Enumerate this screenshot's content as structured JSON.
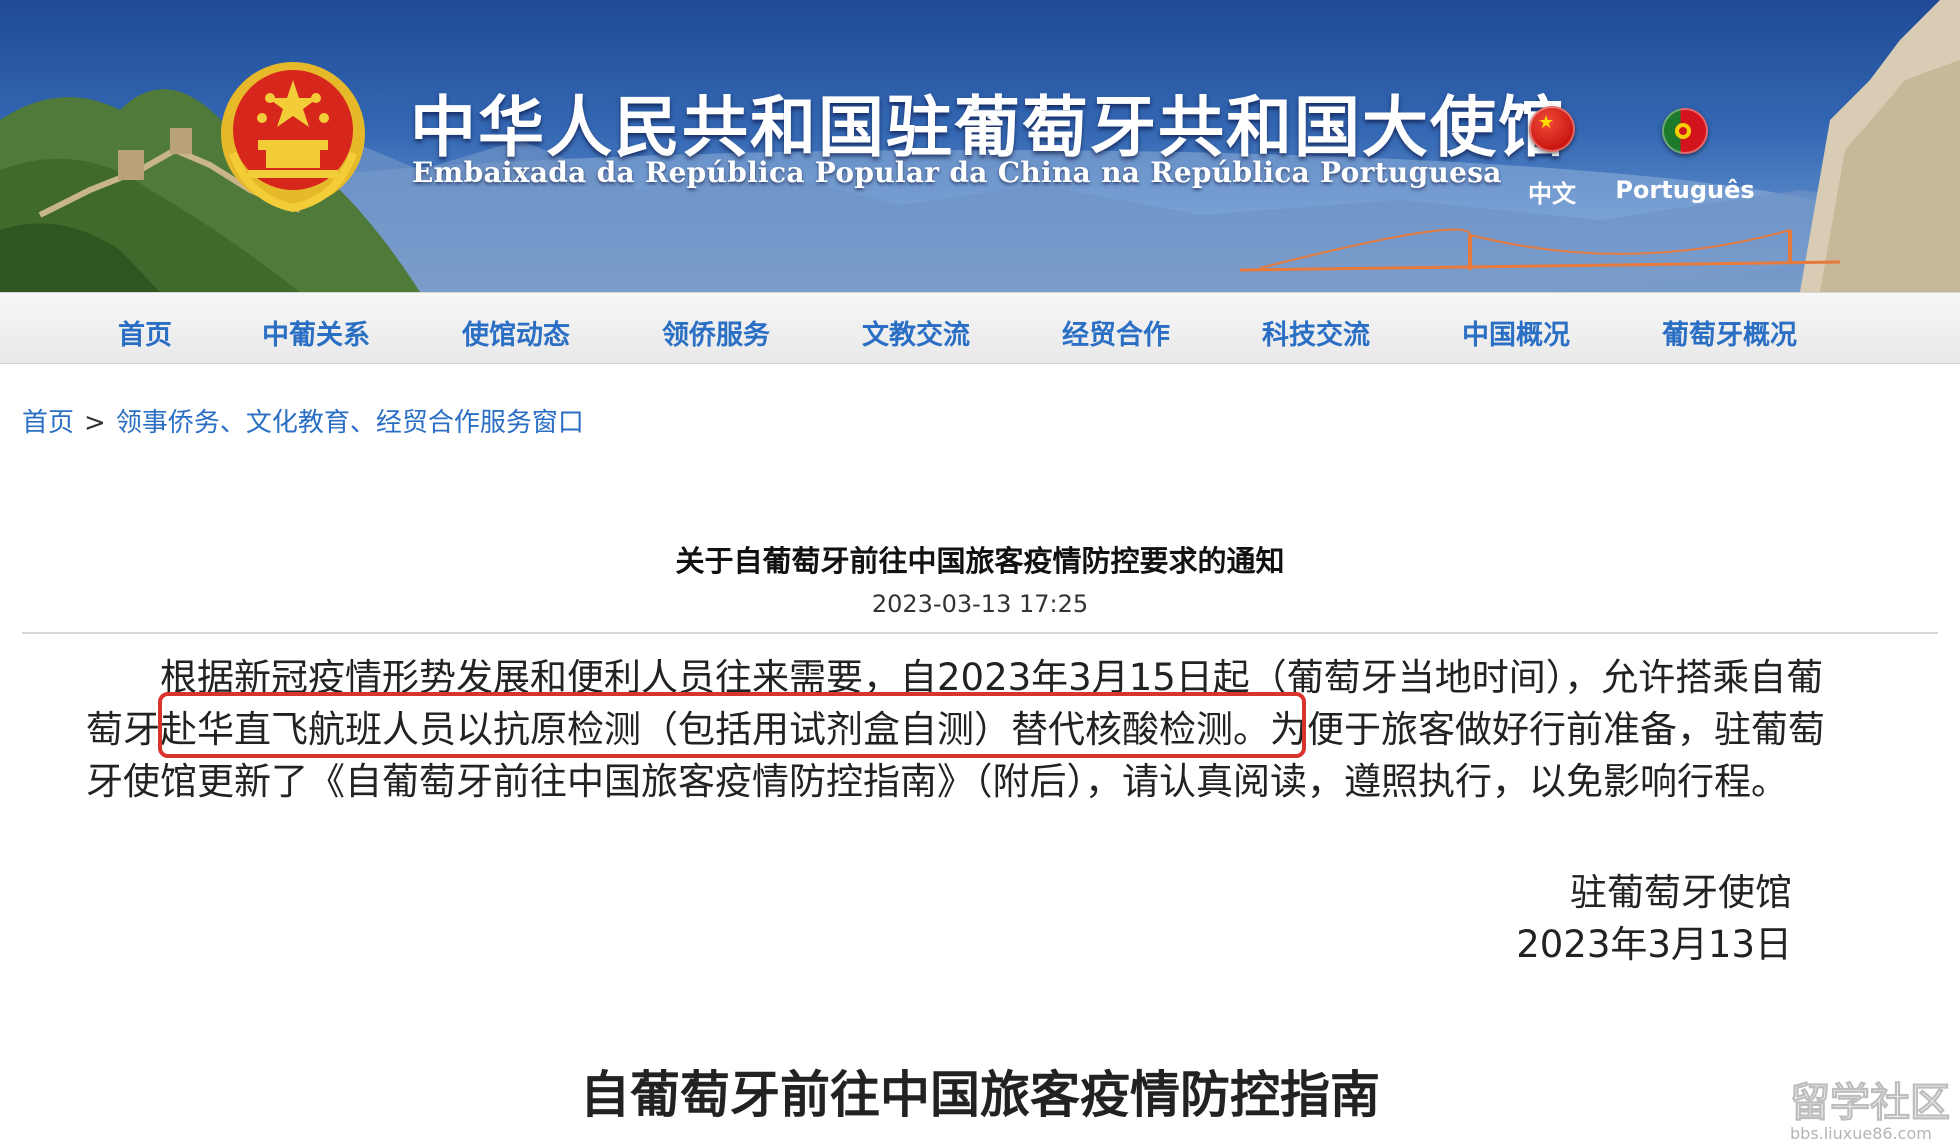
{
  "header": {
    "title_cn": "中华人民共和国驻葡萄牙共和国大使馆",
    "title_pt": "Embaixada da República Popular da China na República Portuguesa",
    "languages": [
      {
        "label": "中文",
        "icon": "china-flag-icon"
      },
      {
        "label": "Português",
        "icon": "portugal-flag-icon"
      }
    ]
  },
  "nav": {
    "items": [
      "首页",
      "中葡关系",
      "使馆动态",
      "领侨服务",
      "文教交流",
      "经贸合作",
      "科技交流",
      "中国概况",
      "葡萄牙概况"
    ]
  },
  "breadcrumb": {
    "home": "首页",
    "separator": ">",
    "current": "领事侨务、文化教育、经贸合作服务窗口"
  },
  "article": {
    "title": "关于自葡萄牙前往中国旅客疫情防控要求的通知",
    "date": "2023-03-13 17:25",
    "lines": [
      "根据新冠疫情形势发展和便利人员往来需要，自2023年3月15日起（葡萄牙当地时间），允许搭乘自葡",
      "萄牙赴华直飞航班人员以抗原检测（包括用试剂盒自测）替代核酸检测。为便于旅客做好行前准备，驻葡萄",
      "牙使馆更新了《自葡萄牙前往中国旅客疫情防控指南》（附后），请认真阅读，遵照执行，以免影响行程。"
    ],
    "signature": "驻葡萄牙使馆",
    "sign_date": "2023年3月13日",
    "guide_title": "自葡萄牙前往中国旅客疫情防控指南"
  },
  "watermark": {
    "main": "留学社区",
    "sub": "bbs.liuxue86.com"
  },
  "colors": {
    "banner": "#2d5fae",
    "nav_link": "#2a6fc4",
    "highlight_border": "#d8342b"
  }
}
